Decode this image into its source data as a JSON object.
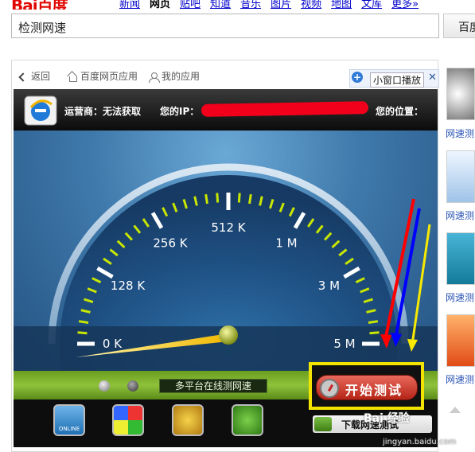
{
  "baidu": {
    "logo_left": "Bai",
    "logo_right": "百度",
    "nav": [
      "新闻",
      "网页",
      "贴吧",
      "知道",
      "音乐",
      "图片",
      "视频",
      "地图",
      "文库",
      "更多»"
    ],
    "nav_current": "网页"
  },
  "search": {
    "value": "检测网速",
    "button": "百度"
  },
  "appbar": {
    "back": "返回",
    "apps_home": "百度网页应用",
    "my_apps": "我的应用",
    "mini_window": "小窗口播放",
    "close": "✕"
  },
  "speedtest": {
    "operator_label": "运营商：无法获取",
    "ip_label": "您的IP：",
    "location_label": "您的位置：",
    "gauge_ticks": [
      "0 K",
      "128 K",
      "256 K",
      "512 K",
      "1 M",
      "3 M",
      "5 M"
    ],
    "needle_value": "0 K",
    "multi_platform": "多平台在线测网速",
    "start_button": "开始测试",
    "download_button": "下载网速测试",
    "app_icon_captions": [
      "ONLINE",
      "",
      "",
      ""
    ]
  },
  "sidebar": {
    "items": [
      "网速测",
      "网速测",
      "网速测",
      "网速测"
    ]
  },
  "watermark": {
    "text": "Bai 经验",
    "url": "jingyan.baidu.com"
  },
  "colors": {
    "brand_red": "#e10602",
    "highlight_yellow": "#f3e400",
    "arrow_red": "#ff0000",
    "arrow_blue": "#0000ff",
    "arrow_yellow": "#f7ea00"
  }
}
